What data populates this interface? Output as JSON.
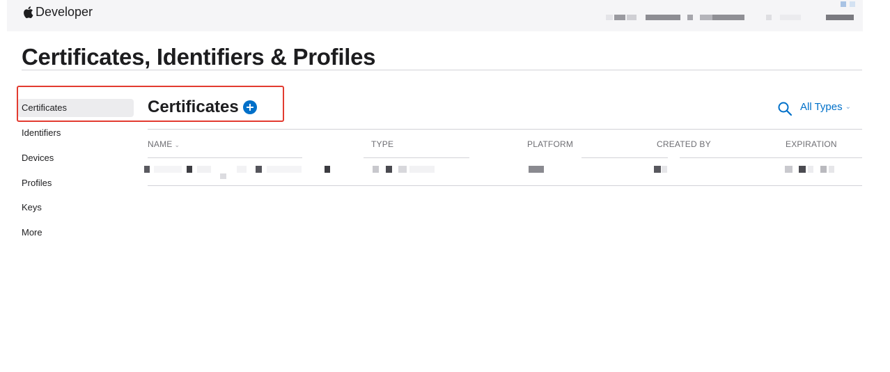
{
  "topbar": {
    "brand_text": "Developer",
    "apple_icon": "apple-logo-icon"
  },
  "page": {
    "title": "Certificates, Identifiers & Profiles"
  },
  "sidebar": {
    "items": [
      {
        "label": "Certificates",
        "active": true
      },
      {
        "label": "Identifiers",
        "active": false
      },
      {
        "label": "Devices",
        "active": false
      },
      {
        "label": "Profiles",
        "active": false
      },
      {
        "label": "Keys",
        "active": false
      },
      {
        "label": "More",
        "active": false
      }
    ]
  },
  "section": {
    "title": "Certificates",
    "add_icon": "plus-circle-icon"
  },
  "toolbar": {
    "search_icon": "search-icon",
    "filter_label": "All Types",
    "filter_chevron": "⌄"
  },
  "table": {
    "columns": [
      {
        "label": "NAME",
        "sortable": true
      },
      {
        "label": "TYPE",
        "sortable": false
      },
      {
        "label": "PLATFORM",
        "sortable": false
      },
      {
        "label": "CREATED BY",
        "sortable": false
      },
      {
        "label": "EXPIRATION",
        "sortable": false
      }
    ],
    "sort_chevron": "⌄",
    "rows_redacted": 1
  },
  "annotation": {
    "highlight_color": "#e23b30"
  },
  "colors": {
    "accent": "#0070c9",
    "topbar_bg": "#f5f5f7",
    "active_item_bg": "#ececee",
    "rule": "#d2d2d7"
  }
}
